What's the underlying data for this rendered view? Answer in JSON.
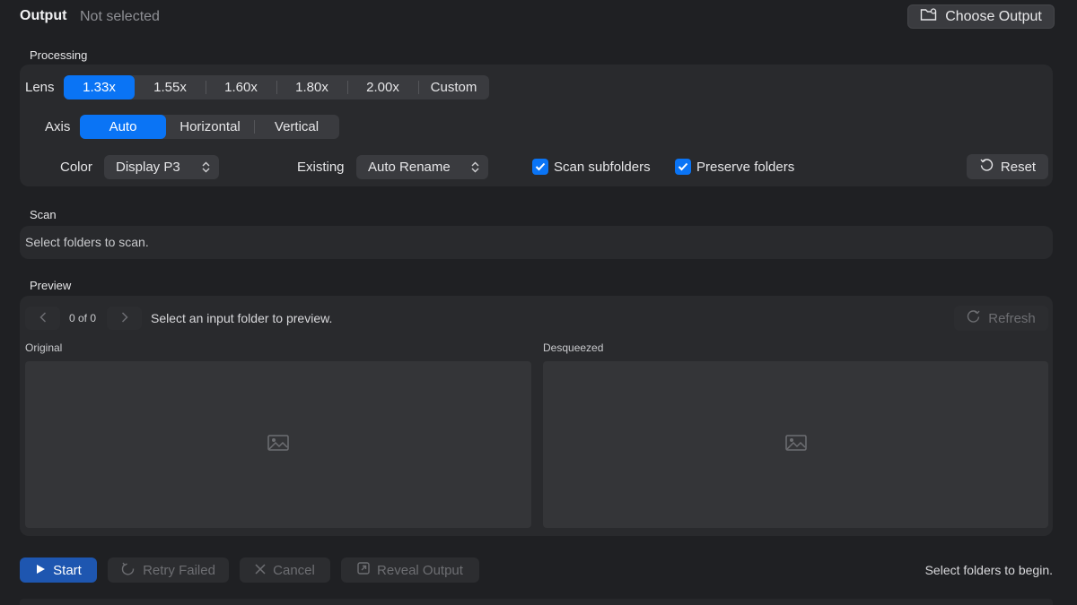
{
  "header": {
    "output_label": "Output",
    "output_status": "Not selected",
    "choose_output_label": "Choose Output"
  },
  "processing": {
    "section_label": "Processing",
    "lens_label": "Lens",
    "lens_options": [
      "1.33x",
      "1.55x",
      "1.60x",
      "1.80x",
      "2.00x",
      "Custom"
    ],
    "lens_selected": "1.33x",
    "axis_label": "Axis",
    "axis_options": [
      "Auto",
      "Horizontal",
      "Vertical"
    ],
    "axis_selected": "Auto",
    "color_label": "Color",
    "color_value": "Display P3",
    "existing_label": "Existing",
    "existing_value": "Auto Rename",
    "scan_subfolders_label": "Scan subfolders",
    "scan_subfolders_checked": true,
    "preserve_folders_label": "Preserve folders",
    "preserve_folders_checked": true,
    "reset_label": "Reset"
  },
  "scan": {
    "section_label": "Scan",
    "message": "Select folders to scan."
  },
  "preview": {
    "section_label": "Preview",
    "counter": "0 of 0",
    "message": "Select an input folder to preview.",
    "refresh_label": "Refresh",
    "original_label": "Original",
    "desqueezed_label": "Desqueezed"
  },
  "footer": {
    "start_label": "Start",
    "retry_label": "Retry Failed",
    "cancel_label": "Cancel",
    "reveal_label": "Reveal Output",
    "status": "Select folders to begin."
  },
  "colors": {
    "accent": "#0a74f5",
    "background": "#1f2023",
    "panel": "#292a2d"
  }
}
